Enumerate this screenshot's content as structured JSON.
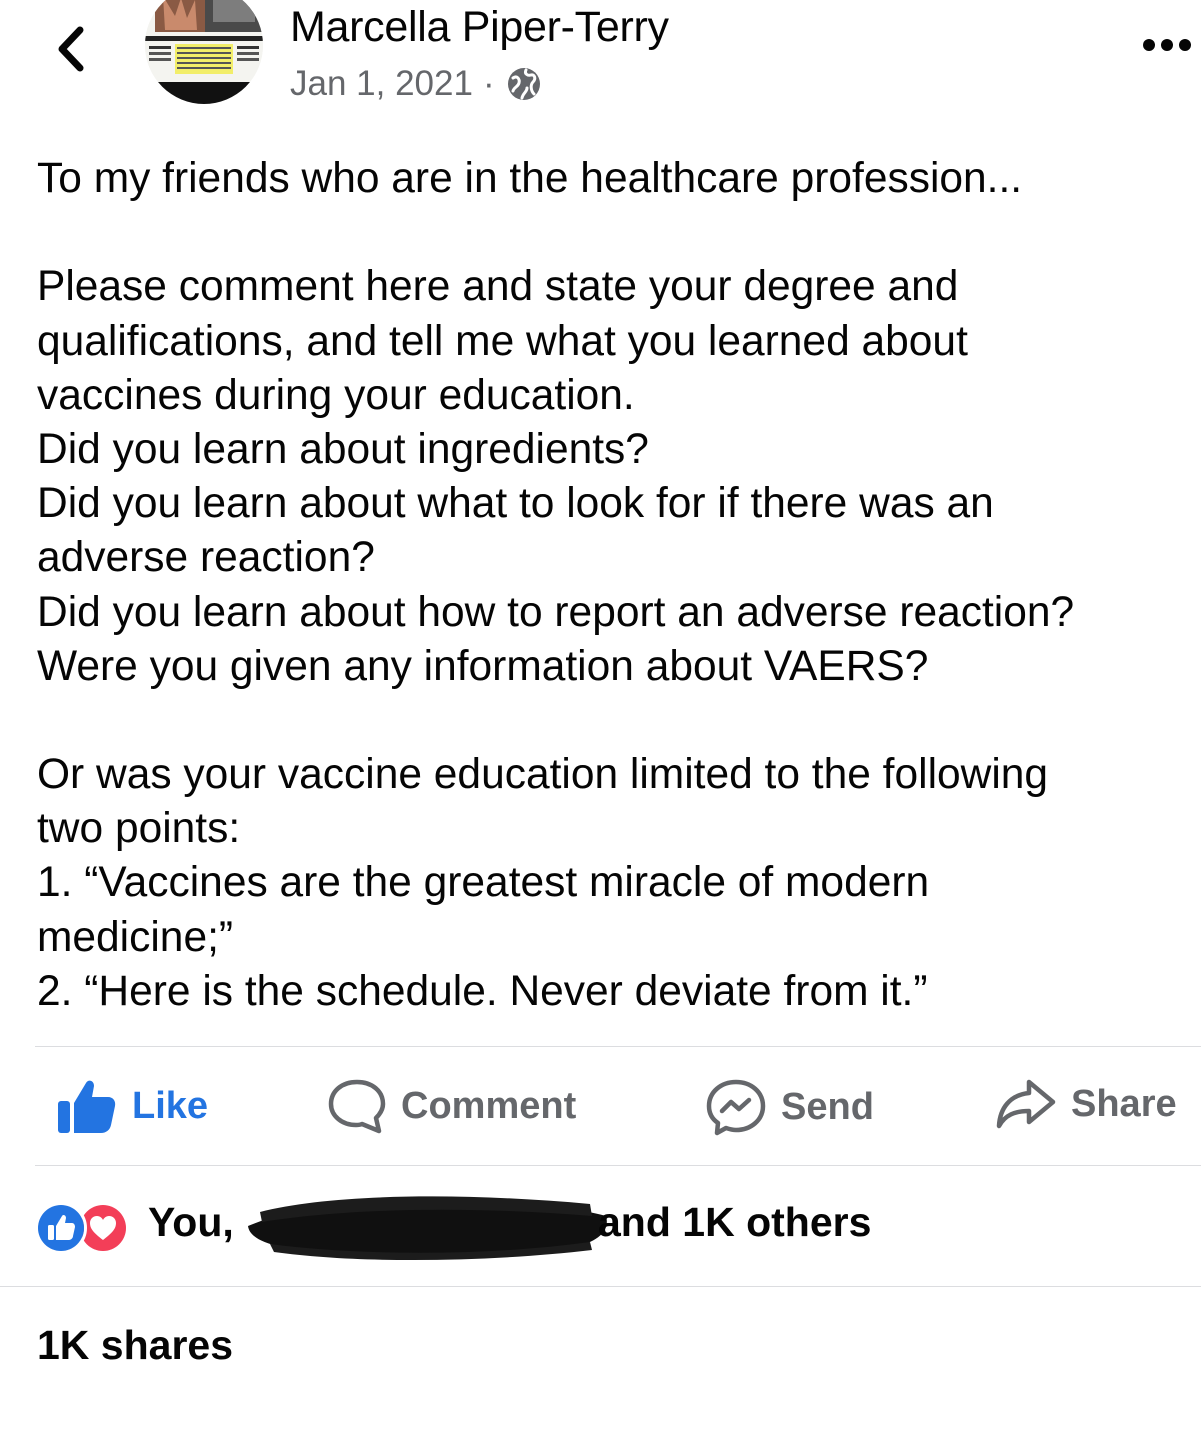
{
  "header": {
    "author_name": "Marcella Piper-Terry",
    "date": "Jan 1, 2021",
    "separator": "·",
    "audience_icon": "globe-icon",
    "back_icon": "chevron-left-icon",
    "more_icon": "more-dots-icon"
  },
  "post": {
    "lines": [
      "To my friends who are in the healthcare profession...",
      "",
      "Please comment here and state your degree and",
      "qualifications, and tell me what you learned about",
      "vaccines during your education.",
      "Did you learn about ingredients?",
      "Did you learn about what to look for if there was an",
      "adverse reaction?",
      "Did you learn about how to report an adverse reaction?",
      "Were you given any information about VAERS?",
      "",
      "Or was your vaccine education limited to the following",
      "two points:",
      "1. “Vaccines are the greatest miracle of modern",
      "medicine;”",
      "2. “Here is the schedule. Never deviate from it.”"
    ]
  },
  "actions": {
    "like_label": "Like",
    "comment_label": "Comment",
    "send_label": "Send",
    "share_label": "Share"
  },
  "reactions": {
    "prefix": "You,",
    "suffix": "and 1K others",
    "icons": [
      "like-reaction-icon",
      "love-reaction-icon"
    ]
  },
  "shares": "1K shares",
  "colors": {
    "brand_blue": "#2374e1",
    "love_red": "#f33e58",
    "secondary_text": "#65676b",
    "divider": "#dcdde0"
  }
}
